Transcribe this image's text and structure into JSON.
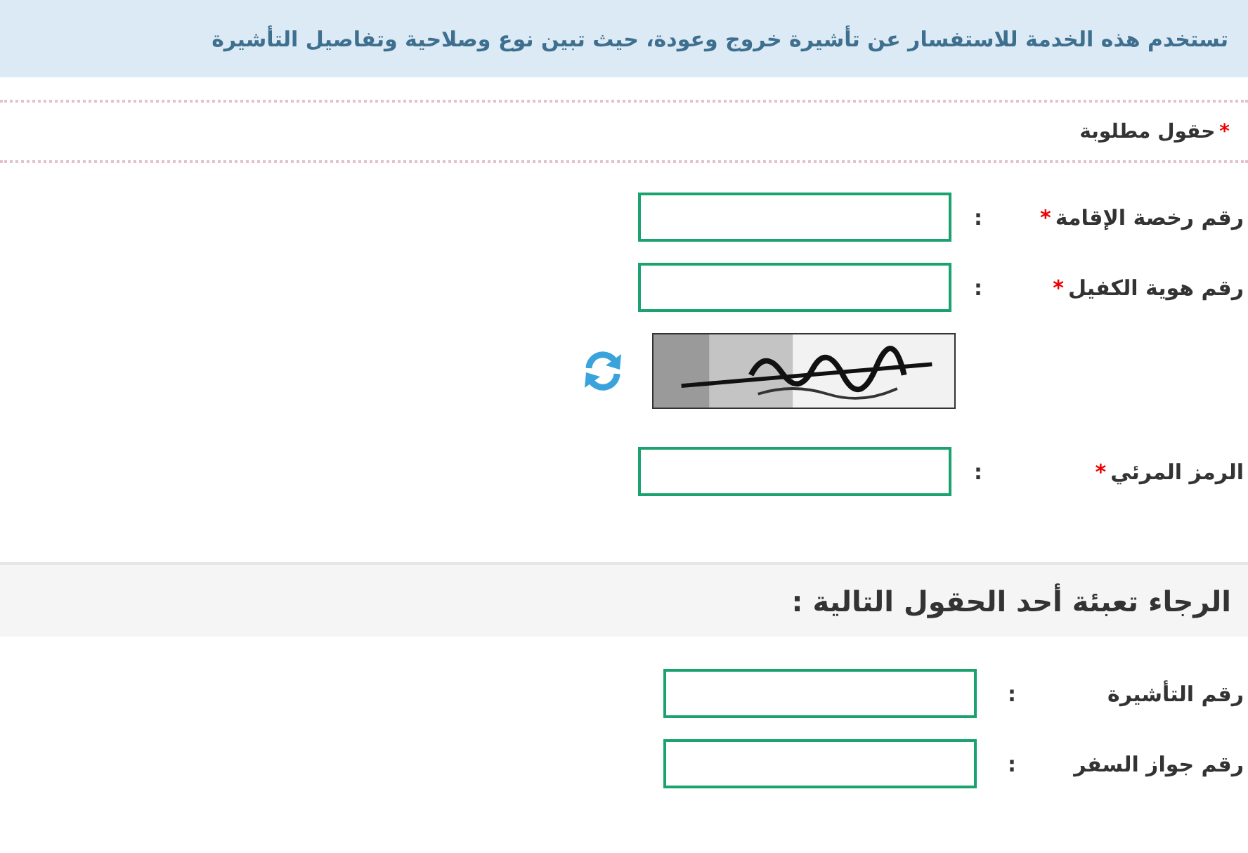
{
  "banner": {
    "text": "تستخدم هذه الخدمة للاستفسار عن تأشيرة خروج وعودة، حيث تبين نوع وصلاحية وتفاصيل التأشيرة"
  },
  "required_note": {
    "mark": "*",
    "text": "حقول مطلوبة"
  },
  "fields": [
    {
      "label": "رقم رخصة الإقامة",
      "mark": "*",
      "colon": ":"
    },
    {
      "label": "رقم هوية الكفيل",
      "mark": "*",
      "colon": ":"
    }
  ],
  "captcha_field": {
    "label": "الرمز المرئي",
    "mark": "*",
    "colon": ":"
  },
  "section": {
    "title": "الرجاء تعبئة أحد الحقول التالية :"
  },
  "optional_fields": [
    {
      "label": "رقم التأشيرة",
      "colon": ":"
    },
    {
      "label": "رقم جواز السفر",
      "colon": ":"
    }
  ]
}
